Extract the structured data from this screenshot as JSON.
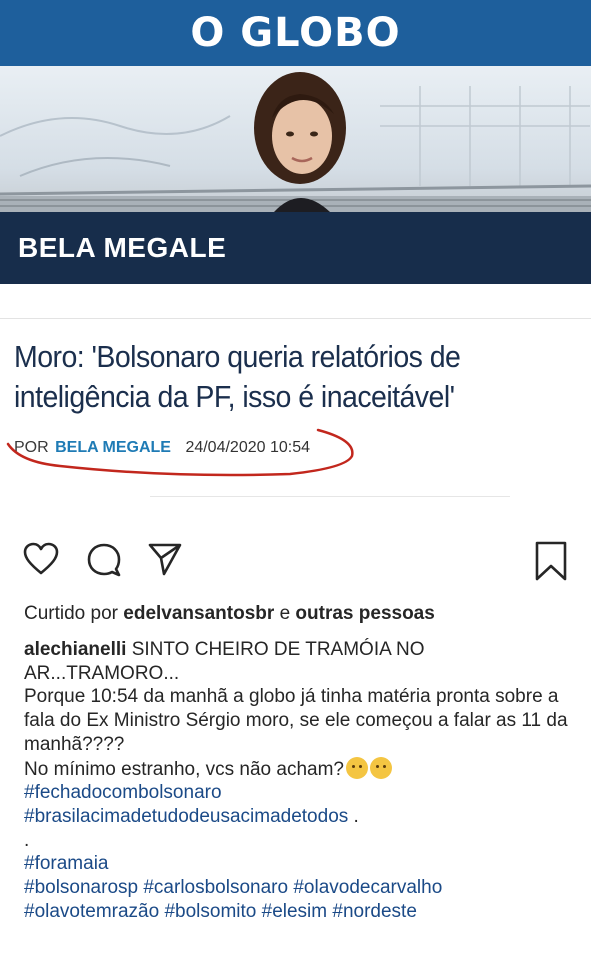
{
  "header": {
    "logo_text": "O GLOBO",
    "columnist": "BELA MEGALE",
    "colors": {
      "brand_blue": "#1e5f9c",
      "navy": "#172d4b"
    }
  },
  "article": {
    "headline": "Moro: 'Bolsonaro queria relatórios de inteligência da PF, isso é inaceitável'",
    "byline_prefix": "POR",
    "byline_author": "BELA MEGALE",
    "byline_datetime": "24/04/2020 10:54"
  },
  "actions": {
    "like_icon": "heart-icon",
    "comment_icon": "comment-icon",
    "share_icon": "send-icon",
    "save_icon": "bookmark-icon"
  },
  "likes": {
    "prefix": "Curtido por",
    "user": "edelvansantosbr",
    "connector": "e",
    "others": "outras pessoas"
  },
  "caption": {
    "username": "alechianelli",
    "line1": "SINTO CHEIRO DE TRAMÓIA NO AR...TRAMORO...",
    "line2": "Porque 10:54 da manhã a globo já tinha matéria pronta sobre a fala do Ex Ministro Sérgio moro, se ele começou a falar as 11 da manhã????",
    "line3": "No mínimo estranho, vcs não acham?",
    "tag1": "#fechadocombolsonaro",
    "tag2": "#brasilacimadetudodeusacimadetodos",
    "tag2_suffix": " .",
    "dot": ".",
    "tag3": "#foramaia",
    "tags_line1": "#bolsonarosp #carlosbolsonaro #olavodecarvalho",
    "tags_line2": "#olavotemrazão #bolsomito #elesim #nordeste"
  }
}
